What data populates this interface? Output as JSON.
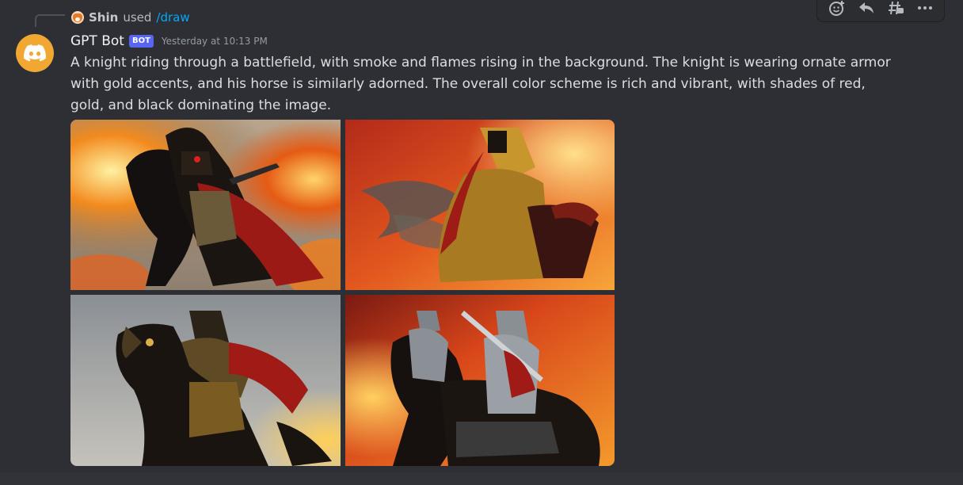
{
  "command": {
    "user": "Shin",
    "used_text": "used",
    "name": "/draw"
  },
  "message": {
    "author": "GPT Bot",
    "bot_tag": "BOT",
    "timestamp": "Yesterday at 10:13 PM",
    "text": "A knight riding through a battlefield, with smoke and flames rising in the background. The knight is wearing ornate armor with gold accents, and his horse is similarly adorned. The overall color scheme is rich and vibrant, with shades of red, gold, and black dominating the image."
  },
  "toolbar": {
    "icons": [
      "add-reaction-icon",
      "reply-icon",
      "create-thread-icon",
      "more-icon"
    ]
  },
  "images": [
    {
      "name": "generated-image-1"
    },
    {
      "name": "generated-image-2"
    },
    {
      "name": "generated-image-3"
    },
    {
      "name": "generated-image-4"
    }
  ],
  "colors": {
    "background": "#2e2f34",
    "bot_tag": "#5865f2",
    "command_link": "#00a8fc",
    "avatar": "#f0a833"
  }
}
